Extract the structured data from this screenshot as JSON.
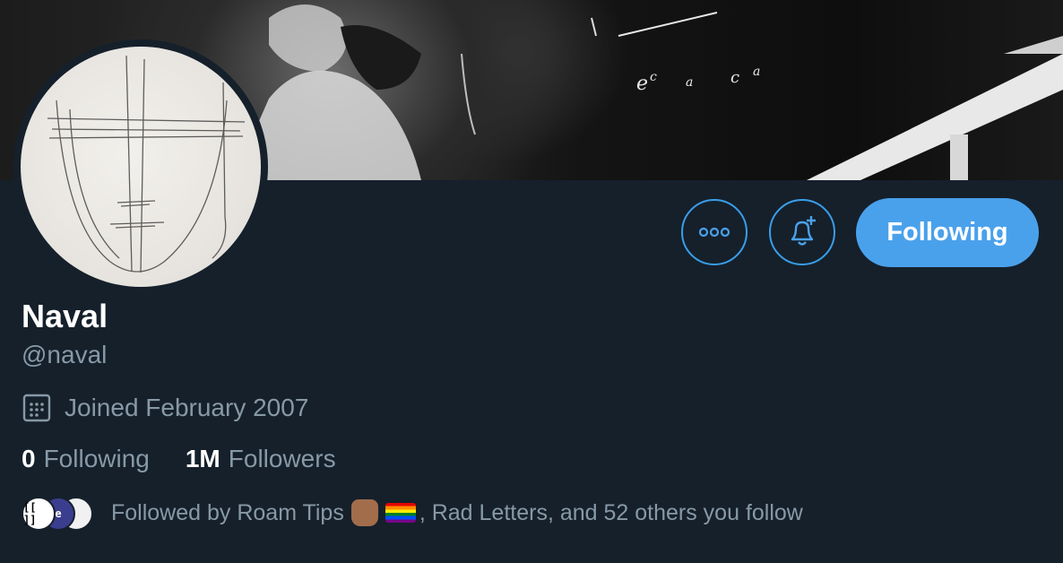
{
  "profile": {
    "display_name": "Naval",
    "handle": "@naval",
    "joined": "Joined February 2007"
  },
  "actions": {
    "following_label": "Following"
  },
  "stats": {
    "following_count": "0",
    "following_label": "Following",
    "followers_count": "1M",
    "followers_label": "Followers"
  },
  "followed_by": {
    "prefix": "Followed by Roam Tips",
    "suffix": ", Rad Letters, and 52 others you follow",
    "avatar_1_text": "[[ ]]",
    "avatar_2_text": "e"
  },
  "colors": {
    "background": "#15202b",
    "accent": "#4aa1eb",
    "secondary_text": "#8899a6"
  },
  "icons": {
    "more": "more-horizontal-icon",
    "notify": "bell-plus-icon",
    "calendar": "calendar-icon"
  }
}
